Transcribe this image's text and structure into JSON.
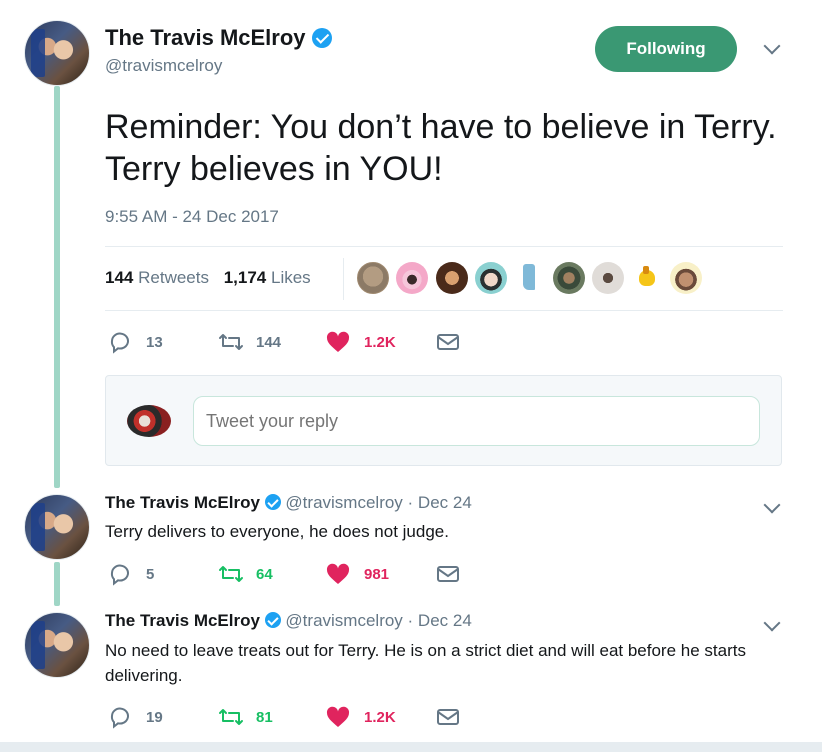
{
  "main_tweet": {
    "author_name": "The Travis McElroy",
    "handle": "@travismcelroy",
    "follow_button": "Following",
    "text": "Reminder: You don’t have to believe in Terry. Terry believes in YOU!",
    "timestamp": "9:55 AM - 24 Dec 2017",
    "retweets_count": "144",
    "retweets_label": "Retweets",
    "likes_count": "1,174",
    "likes_label": "Likes",
    "actions": {
      "replies": "13",
      "retweets": "144",
      "likes": "1.2K"
    }
  },
  "reply_box": {
    "placeholder": "Tweet your reply"
  },
  "thread": [
    {
      "author_name": "The Travis McElroy",
      "handle": "@travismcelroy",
      "date": "· Dec 24",
      "text": "Terry delivers to everyone, he does not judge.",
      "replies": "5",
      "retweets": "64",
      "likes": "981"
    },
    {
      "author_name": "The Travis McElroy",
      "handle": "@travismcelroy",
      "date": "· Dec 24",
      "text": "No need to leave treats out for Terry. He is on a strict diet and will eat before he starts delivering.",
      "replies": "19",
      "retweets": "81",
      "likes": "1.2K"
    }
  ],
  "colors": {
    "follow_bg": "#3a9873",
    "thread_line": "#9fd6c6",
    "like": "#e0245e",
    "retweet_active": "#17bf63"
  }
}
